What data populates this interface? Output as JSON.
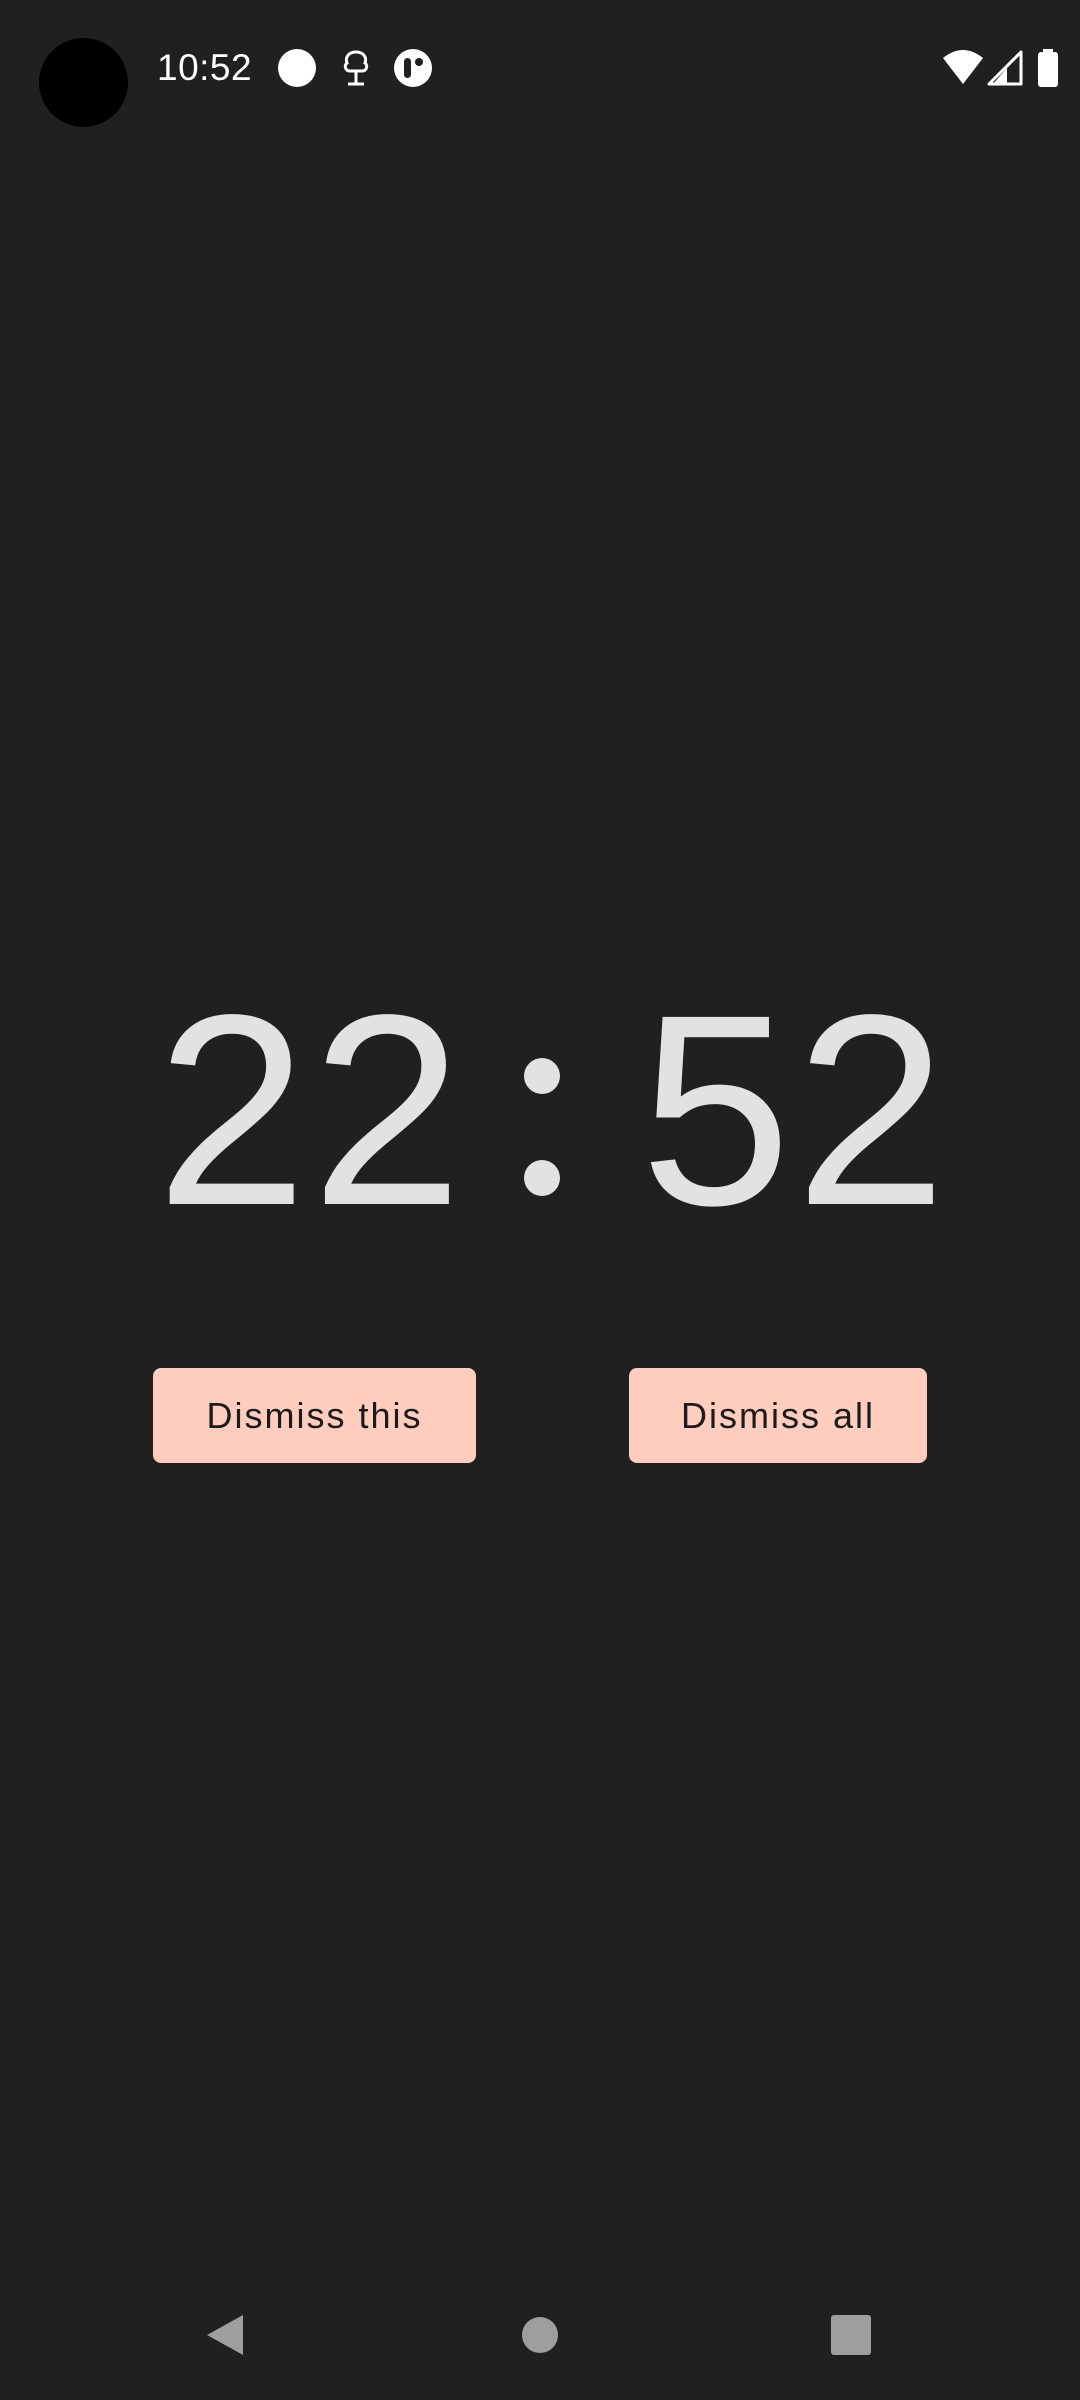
{
  "status_bar": {
    "time": "10:52",
    "left_icons": [
      "circle-notification-icon",
      "tree-notification-icon",
      "app-notification-icon"
    ],
    "right_icons": [
      "wifi-icon",
      "cell-signal-icon",
      "battery-icon"
    ]
  },
  "clock": {
    "hours": "22",
    "separator": ":",
    "minutes": "52"
  },
  "buttons": {
    "dismiss_this": "Dismiss this",
    "dismiss_all": "Dismiss all"
  },
  "nav_bar": {
    "icons": [
      "back-icon",
      "home-icon",
      "recents-icon"
    ]
  },
  "colors": {
    "background": "#202020",
    "clock_text": "#e2e2e2",
    "button_bg": "#ffcdbd",
    "button_text": "#1b1b1b",
    "nav_icon": "#9e9e9e"
  }
}
